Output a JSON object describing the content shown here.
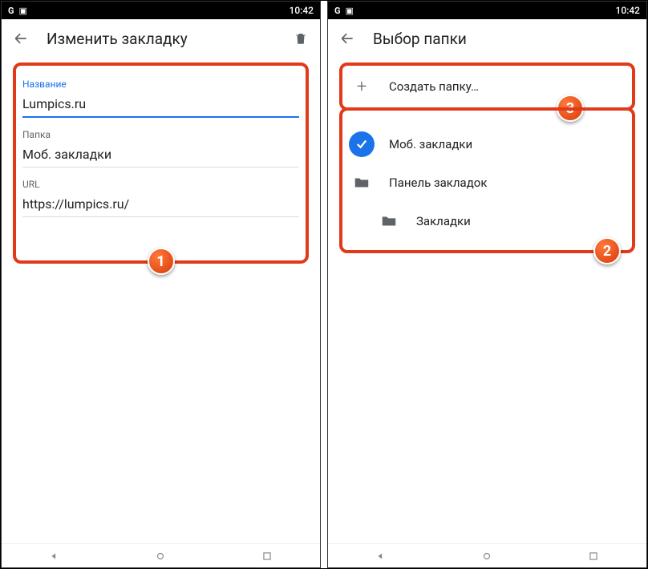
{
  "status": {
    "time": "10:42"
  },
  "left": {
    "title": "Изменить закладку",
    "name_label": "Название",
    "name_value": "Lumpics.ru",
    "folder_label": "Папка",
    "folder_value": "Моб. закладки",
    "url_label": "URL",
    "url_value": "https://lumpics.ru/",
    "badge": "1"
  },
  "right": {
    "title": "Выбор папки",
    "create_label": "Создать папку…",
    "badge_create": "3",
    "items": [
      {
        "label": "Моб. закладки"
      },
      {
        "label": "Панель закладок"
      },
      {
        "label": "Закладки"
      }
    ],
    "badge_list": "2"
  }
}
